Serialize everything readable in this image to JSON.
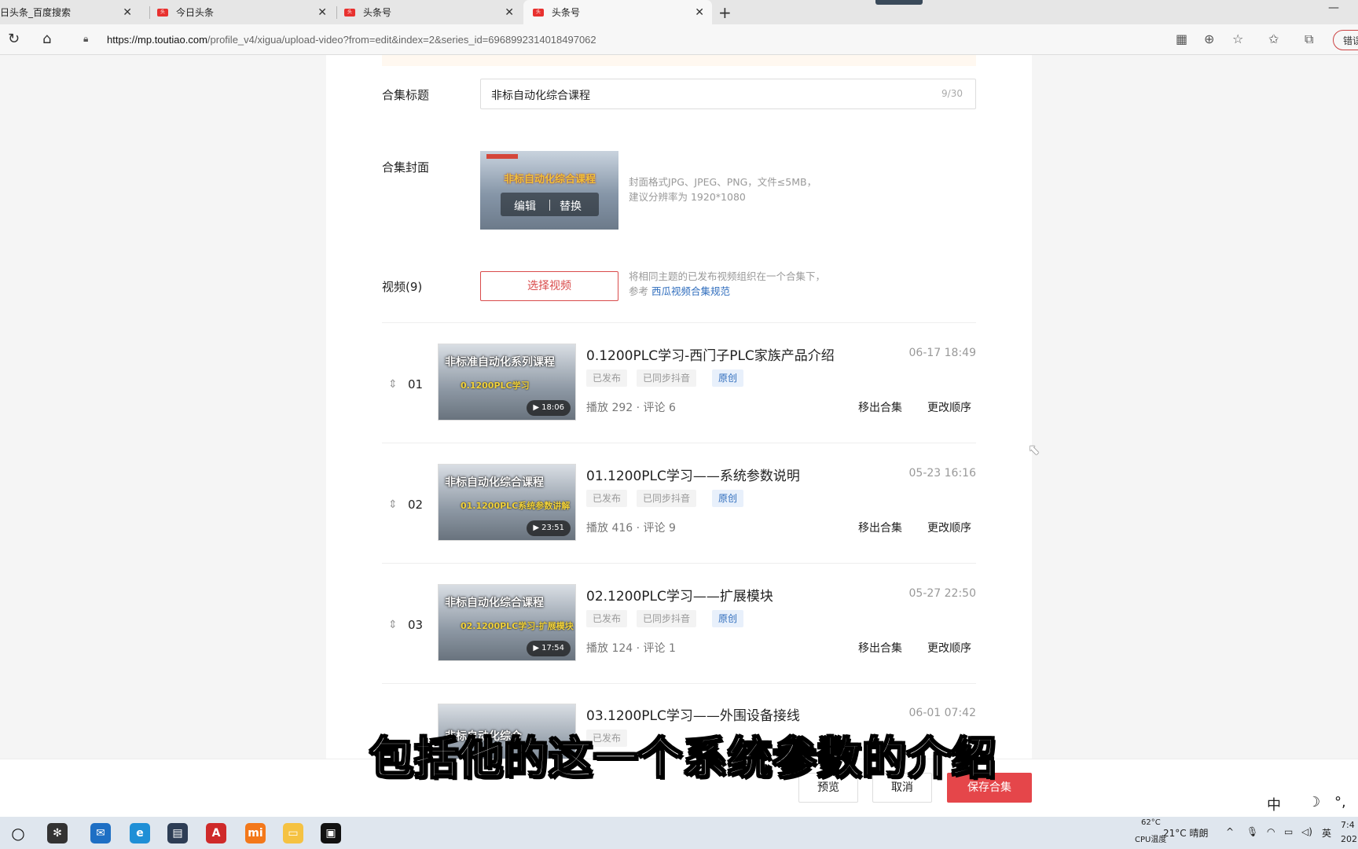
{
  "browser": {
    "tabs": [
      {
        "title": "日头条_百度搜索"
      },
      {
        "title": "今日头条"
      },
      {
        "title": "头条号"
      },
      {
        "title": "头条号"
      }
    ],
    "url_host": "https://mp.toutiao.com",
    "url_path": "/profile_v4/xigua/upload-video?from=edit&index=2&series_id=6968992314018497062",
    "error_pill": "错误"
  },
  "form": {
    "title_label": "合集标题",
    "title_value": "非标自动化综合课程",
    "title_count": "9/30",
    "cover_label": "合集封面",
    "cover_image_text": "非标自动化综合课程",
    "cover_edit": "编辑",
    "cover_replace": "替换",
    "cover_hint_1": "封面格式JPG、JPEG、PNG，文件≤5MB，",
    "cover_hint_2": "建议分辨率为 1920*1080",
    "videos_label": "视频(9)",
    "select_video_button": "选择视频",
    "videos_hint_1": "将相同主题的已发布视频组织在一个合集下，",
    "videos_hint_2_prefix": "参考 ",
    "videos_hint_link": "西瓜视频合集规范"
  },
  "videos": [
    {
      "index": "01",
      "title": "0.1200PLC学习-西门子PLC家族产品介绍",
      "date": "06-17 18:49",
      "tags": [
        "已发布",
        "已同步抖音",
        "原创"
      ],
      "stats": "播放 292 · 评论 6",
      "duration": "▶ 18:06",
      "thumb_title": "非标准自动化系列课程",
      "thumb_sub": "0.1200PLC学习"
    },
    {
      "index": "02",
      "title": "01.1200PLC学习——系统参数说明",
      "date": "05-23 16:16",
      "tags": [
        "已发布",
        "已同步抖音",
        "原创"
      ],
      "stats": "播放 416 · 评论 9",
      "duration": "▶ 23:51",
      "thumb_title": "非标自动化综合课程",
      "thumb_sub": "01.1200PLC系统参数讲解"
    },
    {
      "index": "03",
      "title": "02.1200PLC学习——扩展模块",
      "date": "05-27 22:50",
      "tags": [
        "已发布",
        "已同步抖音",
        "原创"
      ],
      "stats": "播放 124 · 评论 1",
      "duration": "▶ 17:54",
      "thumb_title": "非标自动化综合课程",
      "thumb_sub": "02.1200PLC学习-扩展模块"
    },
    {
      "index": "",
      "title": "03.1200PLC学习——外围设备接线",
      "date": "06-01 07:42",
      "tags": [
        "已发布"
      ],
      "stats": "",
      "duration": "",
      "thumb_title": "非标自动化综合",
      "thumb_sub": ""
    }
  ],
  "row_actions": {
    "remove": "移出合集",
    "reorder": "更改顺序"
  },
  "footer": {
    "preview": "预览",
    "cancel": "取消",
    "save": "保存合集",
    "ime_lang": "中"
  },
  "subtitle": "包括他的这一个系统参数的介绍",
  "taskbar": {
    "cpu_temp": "62°C",
    "cpu_label": "CPU温度",
    "weather": "21°C  晴朗",
    "lang": "英",
    "time": "7:4",
    "date": "202"
  },
  "colors": {
    "accent": "#e5464a",
    "link": "#2f6dbd"
  }
}
